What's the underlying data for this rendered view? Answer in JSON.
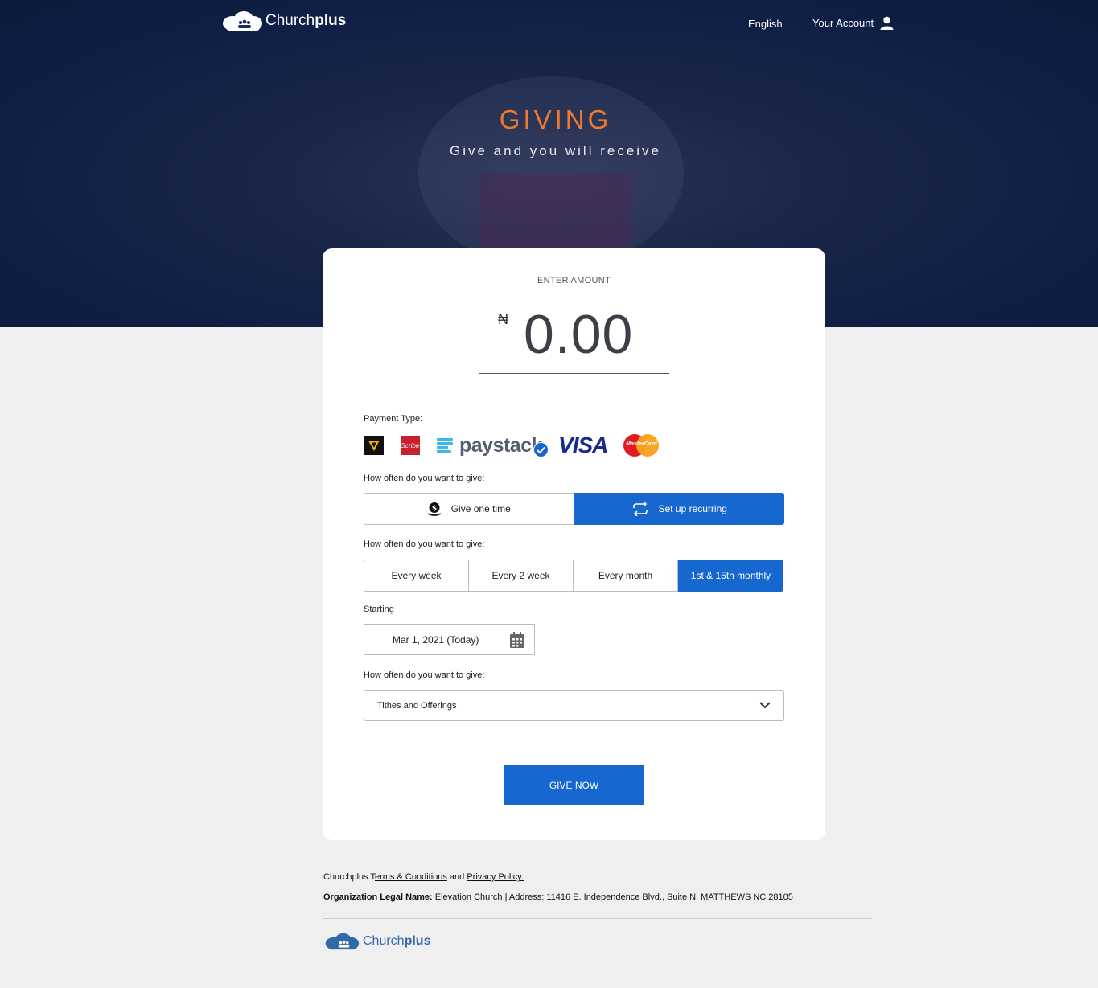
{
  "brand": {
    "name_light": "Church",
    "name_bold": "plus"
  },
  "nav": {
    "language": "English",
    "account": "Your Account"
  },
  "hero": {
    "title": "GIVING",
    "subtitle": "Give and you will receive"
  },
  "amount": {
    "label": "ENTER AMOUNT",
    "currency": "₦",
    "value": "0.00"
  },
  "payment": {
    "label": "Payment Type:",
    "methods": [
      "Bank",
      "Scribe",
      "paystack",
      "VISA",
      "MasterCard"
    ],
    "selected": "paystack"
  },
  "frequency_type": {
    "label": "How often do you want to give:",
    "options": [
      "Give one time",
      "Set up recurring"
    ],
    "selected": "Set up recurring"
  },
  "interval": {
    "label": "How often do you want to give:",
    "options": [
      "Every week",
      "Every 2 week",
      "Every month",
      "1st & 15th monthly"
    ],
    "selected": "1st & 15th monthly"
  },
  "starting": {
    "label": "Starting",
    "value": "Mar 1, 2021 (Today)"
  },
  "purpose": {
    "label": "How often do you want to give:",
    "value": "Tithes and Offerings"
  },
  "give_button": "GIVE NOW",
  "footer": {
    "prefix": "Churchplus T",
    "terms": "erms & Conditions",
    "and": " and ",
    "privacy": "Privacy Policy.",
    "org_label": "Organization Legal Name:",
    "org_value": " Elevation Church | Address: 11416 E. Independence Blvd., Suite N, MATTHEWS NC 28105"
  },
  "colors": {
    "primary": "#1767d0",
    "accent": "#ee7b2d",
    "hero_bg": "#0f1f45"
  }
}
